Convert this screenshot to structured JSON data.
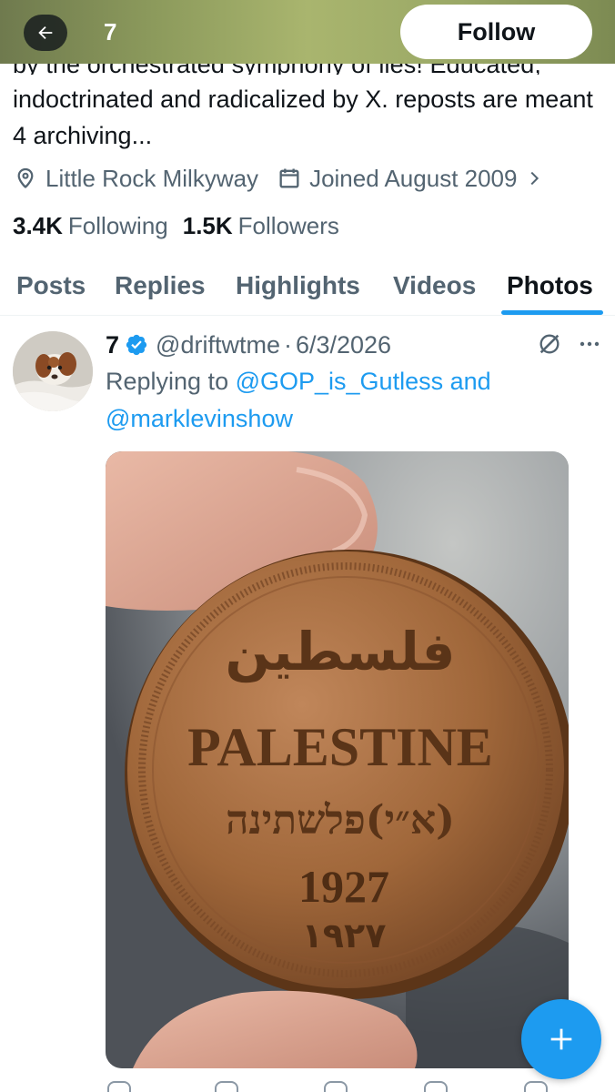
{
  "header": {
    "profile_name": "7",
    "follow_label": "Follow",
    "bg_color": "#8c9a5c"
  },
  "bio": {
    "cut_line": "by the orchestrated symphony of lies! Educated,",
    "text": "indoctrinated and radicalized by X. reposts are meant 4 archiving..."
  },
  "meta": {
    "location": "Little Rock Milkyway",
    "location_icon": "location-pin-icon",
    "joined": "Joined August 2009",
    "joined_icon": "calendar-icon"
  },
  "stats": {
    "following_count": "3.4K",
    "following_label": "Following",
    "followers_count": "1.5K",
    "followers_label": "Followers"
  },
  "tabs": [
    {
      "label": "Posts",
      "active": false
    },
    {
      "label": "Replies",
      "active": false
    },
    {
      "label": "Highlights",
      "active": false
    },
    {
      "label": "Videos",
      "active": false
    },
    {
      "label": "Photos",
      "active": true
    }
  ],
  "tweet": {
    "name": "7",
    "verified": true,
    "handle": "@driftwtme",
    "separator": "·",
    "date": "6/3/2026",
    "reply_prefix": "Replying to",
    "reply_user1": "@GOP_is_Gutless",
    "reply_and": "and",
    "reply_user2": "@marklevinshow",
    "image": {
      "arabic": "فلسطين",
      "english": "PALESTINE",
      "hebrew": "(א״י)פלשתינה",
      "year": "1927",
      "year_arabic": "١٩٢٧"
    }
  },
  "colors": {
    "accent": "#1d9bf0",
    "text_primary": "#0f1419",
    "text_secondary": "#536471",
    "coin": "#a0673a"
  }
}
